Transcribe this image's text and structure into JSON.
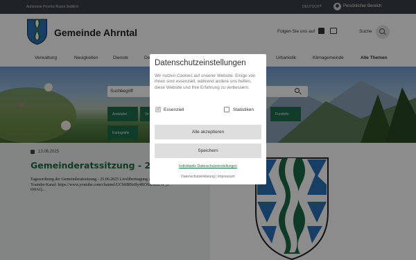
{
  "topbar": {
    "region": "Autonome Provinz Bozen Südtirol",
    "language": "DEUTSCH",
    "user_area": "Persönlicher Bereich"
  },
  "header": {
    "site_title": "Gemeinde Ahrntal",
    "follow_label": "Folgen Sie uns auf",
    "search_label": "Suche"
  },
  "nav": {
    "items": [
      "Verwaltung",
      "Neuigkeiten",
      "Dienste",
      "De",
      "Urbanistik",
      "Klimagemeinde",
      "Alle Themen"
    ]
  },
  "hero": {
    "search_placeholder": "Suchbegriff",
    "tiles": [
      "Amtstafel",
      "Ve",
      "Fundinfo",
      "Kartografie"
    ]
  },
  "article": {
    "date": "13.06.2025",
    "title": "Gemeinderatssitzung - 25.06.2025",
    "text": "Tagesordnung der Gemeinderatssitzung - 25.06.2025 Livelibertragung auf unserem Youtube-Kanal: https://www.youtube.com/channel/UCbMR9zRy4ROSKMbZW_d 6WAQ..."
  },
  "cookie_modal": {
    "title": "Datenschutzeinstellungen",
    "description": "Wir nutzen Cookies auf unserer Website. Einige von ihnen sind essenziell, während andere uns helfen, diese Website und Ihre Erfahrung zu verbessern.",
    "option_essential": "Essenziell",
    "option_statistics": "Statistiken",
    "accept_all": "Alle akzeptieren",
    "save": "Speichern",
    "individual_settings": "Individuelle Datenschutzeinstellungen",
    "footer_links": "Datenschutzerklärung | Impressum"
  },
  "colors": {
    "brand_green": "#1d6b48",
    "crest_blue": "#2a74b8",
    "topbar": "#3a3f45"
  }
}
